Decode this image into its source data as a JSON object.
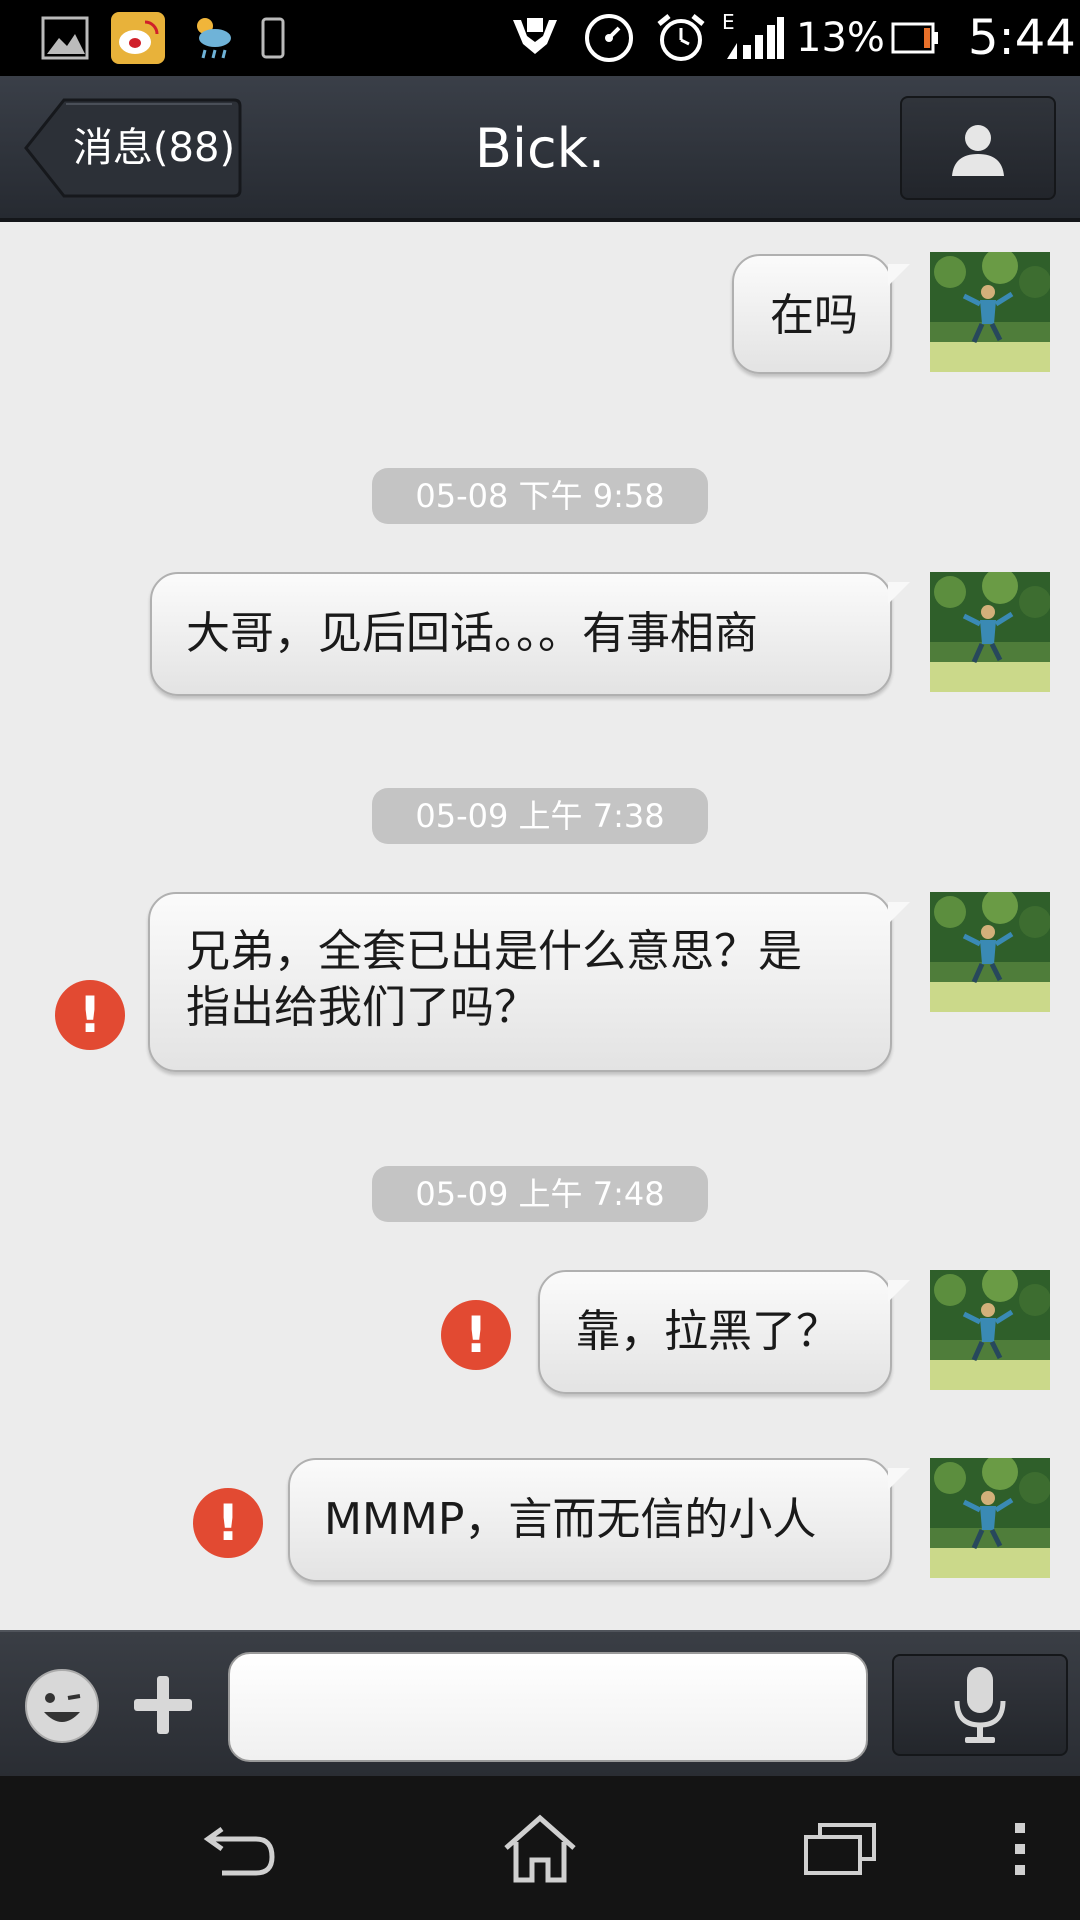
{
  "status_bar": {
    "battery_text": "13%",
    "network_label": "E",
    "time": "5:44",
    "icons": [
      "gallery-icon",
      "weibo-icon",
      "weather-icon",
      "phone-icon",
      "hands-icon",
      "speedometer-icon",
      "alarm-icon",
      "signal-icon",
      "battery-icon"
    ]
  },
  "header": {
    "back_label": "消息(88)",
    "title": "Bick."
  },
  "messages": [
    {
      "text_lines": [
        "在吗"
      ],
      "failed": false
    },
    {
      "timestamp": "05-08 下午 9:58"
    },
    {
      "text_lines": [
        "大哥，见后回话。。。有事相商"
      ],
      "failed": false
    },
    {
      "timestamp": "05-09 上午 7:38"
    },
    {
      "text_lines": [
        "兄弟，全套已出是什么意思？是",
        "指出给我们了吗？"
      ],
      "failed": true
    },
    {
      "timestamp": "05-09 上午 7:48"
    },
    {
      "text_lines": [
        "靠，拉黑了？"
      ],
      "failed": true
    },
    {
      "text_lines": [
        "MMMP，言而无信的小人"
      ],
      "failed": true
    }
  ],
  "error_mark": "!",
  "input": {
    "value": "",
    "placeholder": ""
  },
  "colors": {
    "chat_background": "#ececec",
    "error": "#e24a32",
    "timestamp_bg": "#c4c4c4",
    "header": "#2f333a"
  }
}
